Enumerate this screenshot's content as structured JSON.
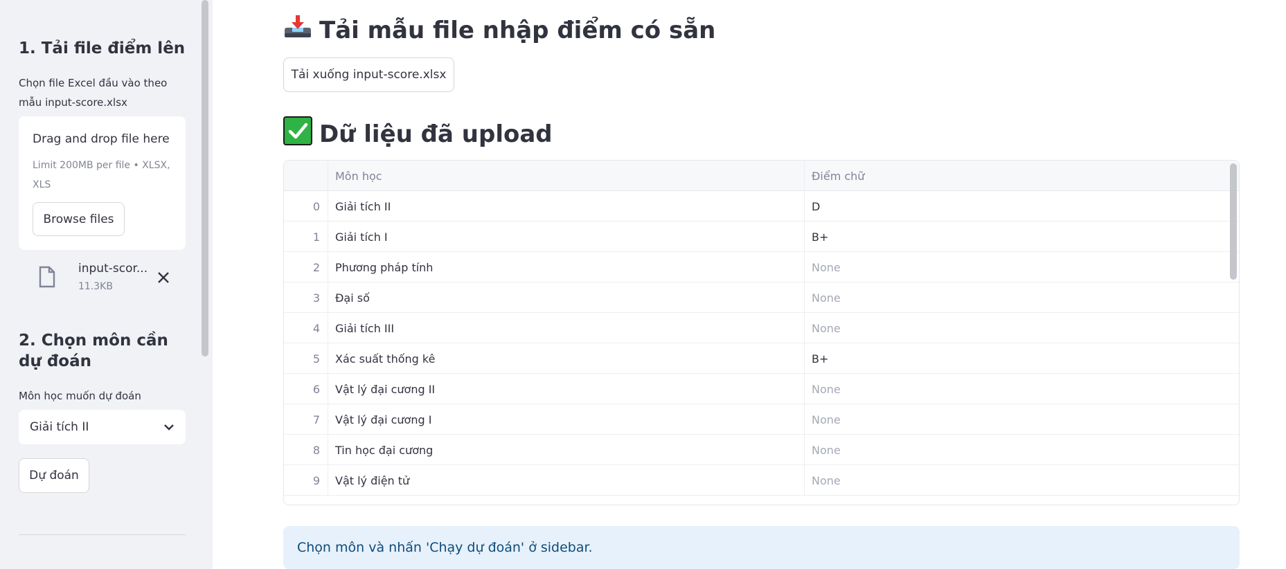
{
  "sidebar": {
    "section1_title": "1. Tải file điểm lên",
    "upload_label": "Chọn file Excel đầu vào theo mẫu input-score.xlsx",
    "dropzone": {
      "title": "Drag and drop file here",
      "limit": "Limit 200MB per file • XLSX, XLS",
      "browse_label": "Browse files"
    },
    "uploaded_file": {
      "name": "input-scor...",
      "size": "11.3KB"
    },
    "section2_title": "2. Chọn môn cần dự đoán",
    "select_label": "Môn học muốn dự đoán",
    "select_value": "Giải tích II",
    "predict_label": "Dự đoán"
  },
  "main": {
    "download_heading": "Tải mẫu file nhập điểm có sẵn",
    "download_button": "Tải xuống input-score.xlsx",
    "data_heading": "Dữ liệu đã upload",
    "table": {
      "columns": [
        "Môn học",
        "Điểm chữ"
      ],
      "rows": [
        {
          "index": "0",
          "subject": "Giải tích II",
          "grade": "D"
        },
        {
          "index": "1",
          "subject": "Giải tích I",
          "grade": "B+"
        },
        {
          "index": "2",
          "subject": "Phương pháp tính",
          "grade": "None"
        },
        {
          "index": "3",
          "subject": "Đại số",
          "grade": "None"
        },
        {
          "index": "4",
          "subject": "Giải tích III",
          "grade": "None"
        },
        {
          "index": "5",
          "subject": "Xác suất thống kê",
          "grade": "B+"
        },
        {
          "index": "6",
          "subject": "Vật lý đại cương II",
          "grade": "None"
        },
        {
          "index": "7",
          "subject": "Vật lý đại cương I",
          "grade": "None"
        },
        {
          "index": "8",
          "subject": "Tin học đại cương",
          "grade": "None"
        },
        {
          "index": "9",
          "subject": "Vật lý điện tử",
          "grade": "None"
        }
      ]
    },
    "info_message": "Chọn môn và nhấn 'Chạy dự đoán' ở sidebar."
  },
  "icons": {
    "download": "inbox-tray-icon",
    "check": "check-mark-icon",
    "file": "file-icon",
    "close": "close-icon",
    "chevron": "chevron-down-icon"
  }
}
